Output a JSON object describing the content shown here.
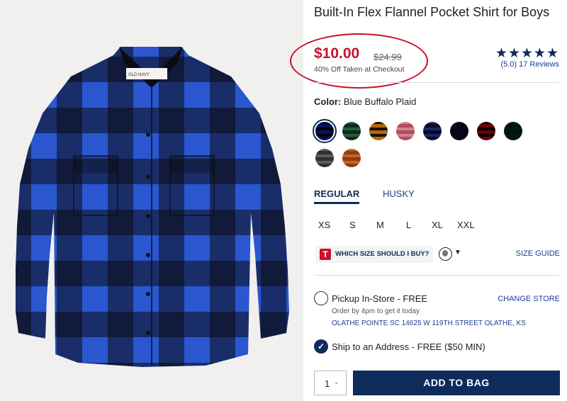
{
  "product": {
    "title": "Built-In Flex Flannel Pocket Shirt for Boys",
    "price": "$10.00",
    "original_price": "$24.99",
    "discount_note": "40% Off Taken at Checkout",
    "rating_stars": "★★★★★",
    "reviews": "(5.0) 17 Reviews",
    "tag_brand_text": "OLD NAVY"
  },
  "color": {
    "label": "Color:",
    "value": "Blue Buffalo Plaid",
    "swatches": [
      {
        "name": "Blue Buffalo Plaid",
        "c1": "#1d3f9e",
        "c2": "#111111",
        "selected": true
      },
      {
        "name": "Green Plaid",
        "c1": "#2f6b4c",
        "c2": "#d9d6cc"
      },
      {
        "name": "Yellow Plaid",
        "c1": "#d7a22d",
        "c2": "#1a1a1a"
      },
      {
        "name": "Red White Plaid",
        "c1": "#d88a9a",
        "c2": "#f3f3f3"
      },
      {
        "name": "Navy Plaid",
        "c1": "#24336b",
        "c2": "#c8c9d4"
      },
      {
        "name": "Purple",
        "c1": "#2a1847",
        "c2": "#3a2460"
      },
      {
        "name": "Red Plaid",
        "c1": "#a50f1f",
        "c2": "#111111"
      },
      {
        "name": "Green",
        "c1": "#0f4a3a",
        "c2": "#165c47"
      },
      {
        "name": "Gray Plaid",
        "c1": "#6f6f6f",
        "c2": "#d5d5d5"
      },
      {
        "name": "Orange Plaid",
        "c1": "#c47a35",
        "c2": "#f0dfc8"
      }
    ]
  },
  "fit": {
    "tabs": [
      "REGULAR",
      "HUSKY"
    ],
    "active": "REGULAR"
  },
  "sizes": [
    "XS",
    "S",
    "M",
    "L",
    "XL",
    "XXL"
  ],
  "size_help": {
    "logo": "T",
    "text": "WHICH SIZE SHOULD I BUY?",
    "guide": "SIZE GUIDE"
  },
  "fulfillment": {
    "pickup_label": "Pickup In-Store - FREE",
    "change_store": "CHANGE STORE",
    "order_by": "Order by 4pm to get it today",
    "store_address": "OLATHE POINTE SC 14625 W 119TH STREET  OLATHE, KS",
    "ship_label": "Ship to an Address - FREE ($50 MIN)"
  },
  "cart": {
    "quantity": "1",
    "add_label": "ADD TO BAG"
  },
  "colors": {
    "price_red": "#c8102e",
    "navy": "#0f2b5b",
    "link_blue": "#1a3e8c",
    "plaid_blue": "#2a57d0",
    "plaid_black": "#0b0b14"
  }
}
